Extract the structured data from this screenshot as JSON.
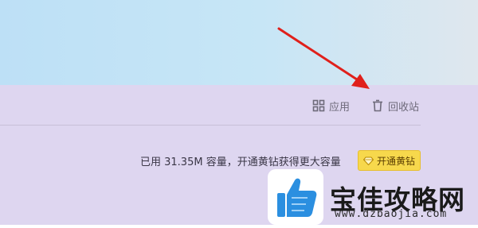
{
  "toolbar": {
    "apps_label": "应用",
    "recycle_label": "回收站"
  },
  "storage": {
    "quota_text": "已用 31.35M 容量，开通黄钻获得更大容量",
    "upgrade_label": "开通黄钻"
  },
  "watermark": {
    "title": "宝佳攻略网",
    "url": "www.dzbaojia.com"
  },
  "colors": {
    "panel_bg": "#ded6f0",
    "banner_bg": "#c7e6f6",
    "vip_button": "#f7d84c",
    "arrow": "#e0201b"
  },
  "icons": {
    "apps": "grid-icon",
    "recycle": "trash-icon",
    "vip": "diamond-icon"
  }
}
